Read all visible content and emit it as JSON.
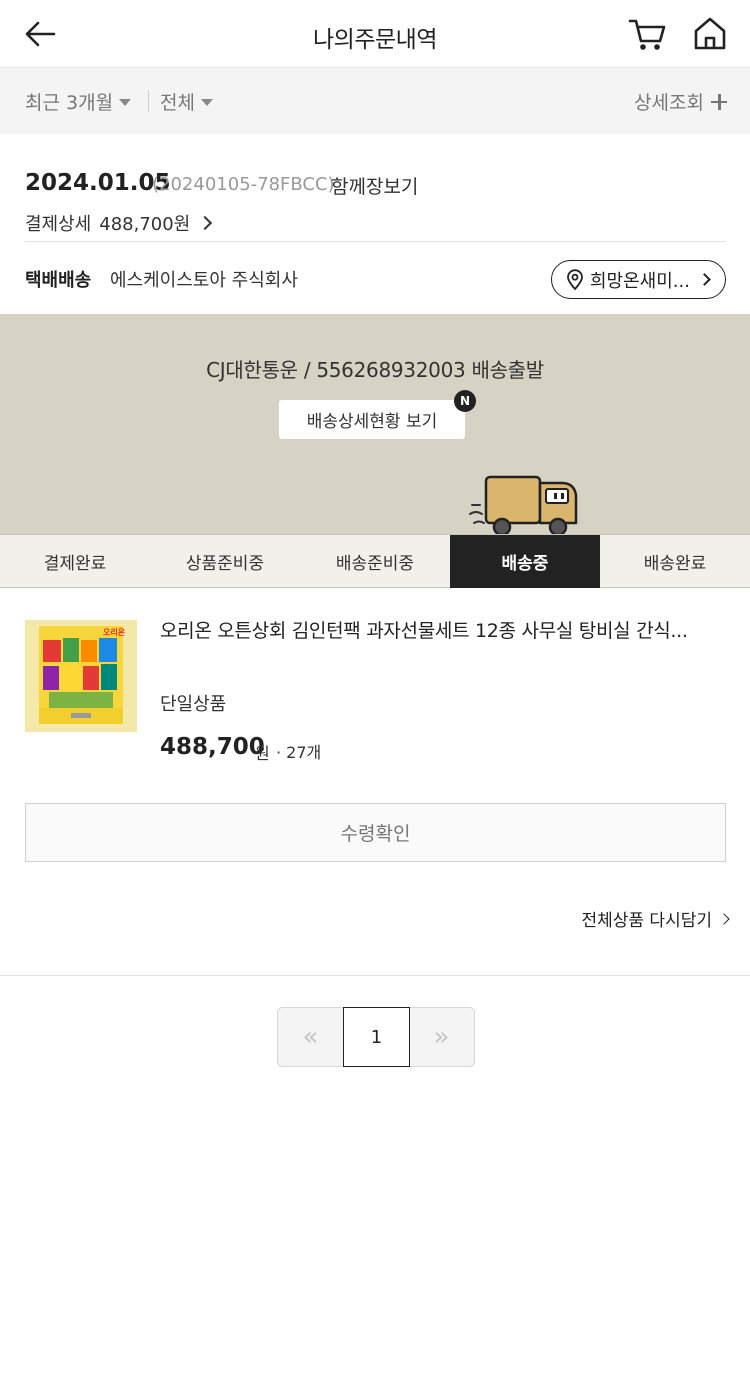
{
  "header": {
    "title": "나의주문내역"
  },
  "filters": {
    "period": "최근 3개월",
    "category": "전체",
    "detail_search": "상세조회"
  },
  "order": {
    "date": "2024.01.05",
    "order_number": "(20240105-78FBCC)",
    "shop": "함께장보기",
    "payment_label": "결제상세",
    "payment_amount": "488,700원",
    "shipping_type": "택배배송",
    "shipping_company": "에스케이스토아 주식회사",
    "address_button": "희망온새미..."
  },
  "delivery": {
    "tracking_text": "CJ대한통운 / 556268932003 배송출발",
    "detail_button": "배송상세현황 보기",
    "new_badge": "N",
    "panel_color": "#d6d2c4"
  },
  "steps": [
    {
      "label": "결제완료",
      "active": false
    },
    {
      "label": "상품준비중",
      "active": false
    },
    {
      "label": "배송준비중",
      "active": false
    },
    {
      "label": "배송중",
      "active": true
    },
    {
      "label": "배송완료",
      "active": false
    }
  ],
  "product": {
    "name": "오리온 오튼상회 김인턴팩 과자선물세트 12종 사무실 탕비실 간식...",
    "option": "단일상품",
    "price": "488,700",
    "currency": "원",
    "quantity": "· 27개",
    "image_label": "오리온"
  },
  "actions": {
    "confirm_receipt": "수령확인",
    "re_add_all": "전체상품 다시담기"
  },
  "pagination": {
    "prev": "«",
    "current": "1",
    "next": "»"
  }
}
